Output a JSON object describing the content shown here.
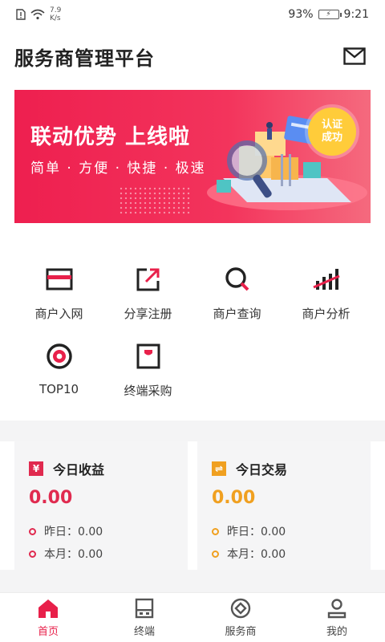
{
  "status_bar": {
    "speed_value": "7.9",
    "speed_unit": "K/s",
    "battery": "93%",
    "time": "9:21"
  },
  "header": {
    "title": "服务商管理平台"
  },
  "banner": {
    "title": "联动优势 上线啦",
    "subtitle": "简单 · 方便 · 快捷 · 极速",
    "badge_line1": "认证",
    "badge_line2": "成功"
  },
  "menu": {
    "items": [
      {
        "label": "商户入网",
        "icon": "card-icon"
      },
      {
        "label": "分享注册",
        "icon": "share-icon"
      },
      {
        "label": "商户查询",
        "icon": "search-icon"
      },
      {
        "label": "商户分析",
        "icon": "analysis-icon"
      },
      {
        "label": "TOP10",
        "icon": "target-icon"
      },
      {
        "label": "终端采购",
        "icon": "terminal-icon"
      }
    ]
  },
  "stats": {
    "income": {
      "icon_symbol": "¥",
      "title": "今日收益",
      "value": "0.00",
      "yesterday": "昨日：0.00",
      "month": "本月：0.00"
    },
    "trade": {
      "icon_symbol": "⇌",
      "title": "今日交易",
      "value": "0.00",
      "yesterday": "昨日：0.00",
      "month": "本月：0.00"
    }
  },
  "tabbar": {
    "items": [
      {
        "label": "首页",
        "icon": "home-icon",
        "active": true
      },
      {
        "label": "终端",
        "icon": "terminal-icon",
        "active": false
      },
      {
        "label": "服务商",
        "icon": "provider-icon",
        "active": false
      },
      {
        "label": "我的",
        "icon": "profile-icon",
        "active": false
      }
    ]
  },
  "colors": {
    "accent": "#e8204a",
    "income": "#e02a4f",
    "trade": "#f0a020"
  }
}
